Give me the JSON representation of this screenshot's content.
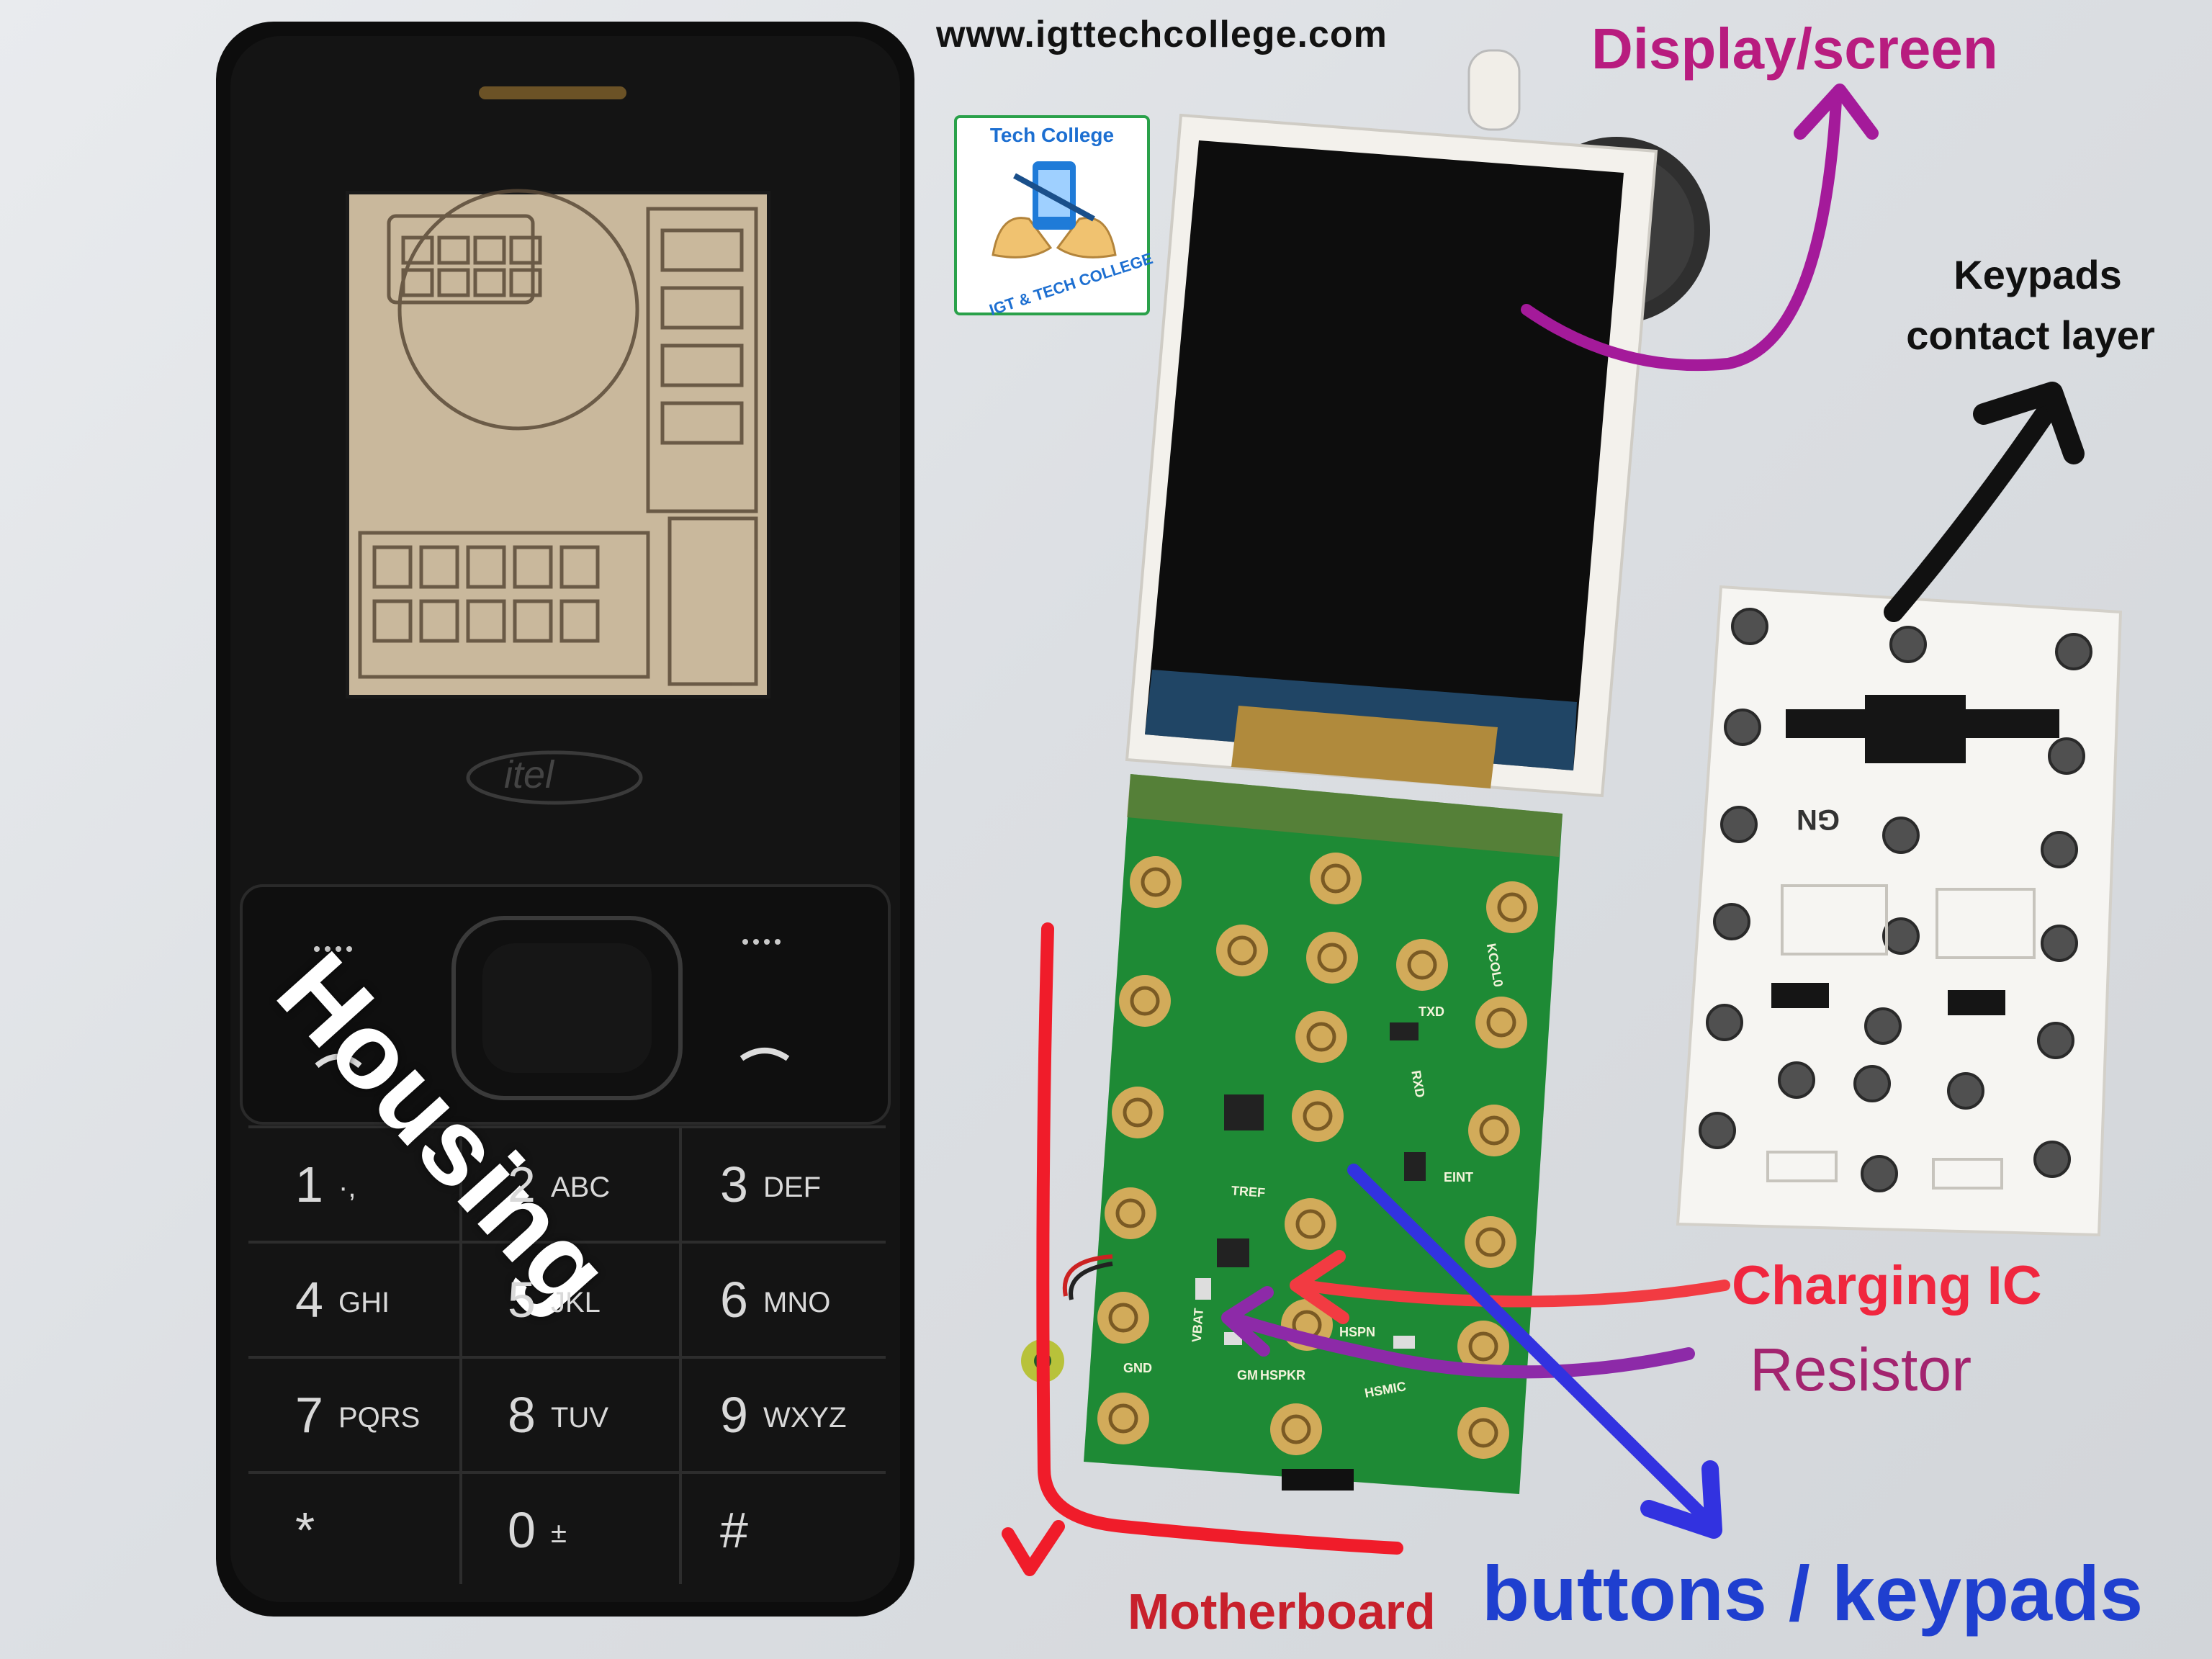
{
  "header": {
    "site_url": "www.igttechcollege.com"
  },
  "logo": {
    "title": "Tech College",
    "arc_text": "IGT & TECH COLLEGE"
  },
  "labels": {
    "display": "Display/screen",
    "keypads_line1": "Keypads",
    "keypads_line2": "contact layer",
    "housing": "Housing",
    "charging_ic": "Charging IC",
    "resistor": "Resistor",
    "motherboard": "Motherboard",
    "buttons": "buttons / keypads"
  },
  "phone": {
    "brand": "itel",
    "keys": [
      {
        "num": "1",
        "letters": "·,"
      },
      {
        "num": "2",
        "letters": "ABC"
      },
      {
        "num": "3",
        "letters": "DEF"
      },
      {
        "num": "4",
        "letters": "GHI"
      },
      {
        "num": "5",
        "letters": "JKL"
      },
      {
        "num": "6",
        "letters": "MNO"
      },
      {
        "num": "7",
        "letters": "PQRS"
      },
      {
        "num": "8",
        "letters": "TUV"
      },
      {
        "num": "9",
        "letters": "WXYZ"
      },
      {
        "num": "*",
        "letters": ""
      },
      {
        "num": "0",
        "letters": "±"
      },
      {
        "num": "#",
        "letters": ""
      }
    ]
  },
  "pcb_markings": {
    "tref": "TREF",
    "vbat": "VBAT",
    "gnd": "GND",
    "hspkr": "HSPKR",
    "hsmic": "HSMIC",
    "eint": "EINT",
    "txd": "TXD",
    "rxd": "RXD",
    "kcol": "KCOL0",
    "hspn": "HSPN",
    "gm": "GM"
  },
  "contact_layer": {
    "marking": "GN"
  },
  "colors": {
    "display_label": "#b81c7f",
    "charging_label": "#f0263e",
    "resistor_label": "#a3246f",
    "motherboard_label": "#c8202c",
    "buttons_label": "#1f3fcf",
    "pcb_green": "#1e8a35",
    "pad_gold": "#d2ab5a"
  }
}
